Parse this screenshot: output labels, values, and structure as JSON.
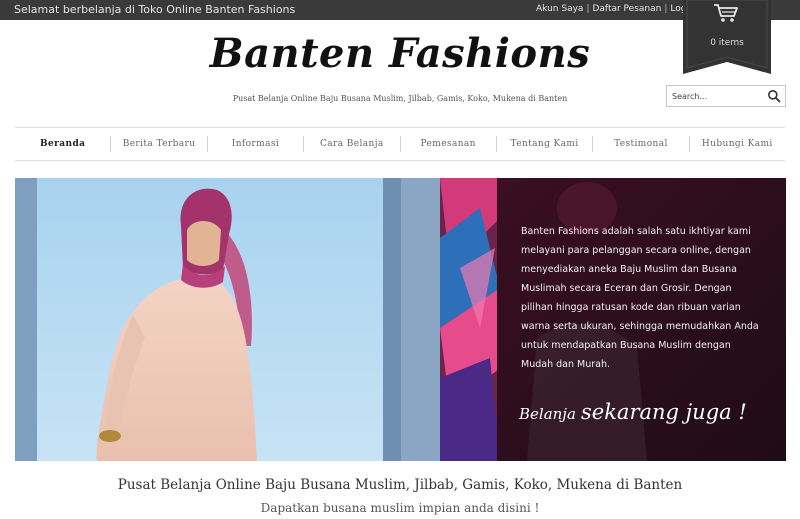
{
  "topbar": {
    "welcome": "Selamat berbelanja di Toko Online Banten Fashions",
    "links": [
      "Akun Saya",
      "Daftar Pesanan",
      "Login"
    ]
  },
  "cart": {
    "items_label": "0 items",
    "icon": "shopping-cart-icon"
  },
  "header": {
    "logo": "Banten Fashions",
    "tagline": "Pusat Belanja Online Baju Busana Muslim, Jilbab, Gamis, Koko, Mukena di Banten"
  },
  "search": {
    "placeholder": "Search..."
  },
  "nav": {
    "items": [
      "Beranda",
      "Berita Terbaru",
      "Informasi",
      "Cara Belanja",
      "Pemesanan",
      "Tentang Kami",
      "Testimonal",
      "Hubungi Kami"
    ],
    "active": "Beranda"
  },
  "banner": {
    "text": "Banten Fashions adalah salah satu ikhtiyar kami melayani para pelanggan secara online, dengan menyediakan aneka Baju Muslim dan Busana Muslimah secara Eceran dan Grosir. Dengan pilihan hingga ratusan kode dan ribuan varian warna serta ukuran, sehingga memudahkan Anda untuk mendapatkan Busana Muslim dengan Mudah dan Murah.",
    "cta_small": "Belanja",
    "cta_big": "sekarang juga !"
  },
  "main": {
    "heading": "Pusat Belanja Online Baju Busana Muslim, Jilbab, Gamis, Koko, Mukena di Banten",
    "subheading": "Dapatkan busana muslim impian anda disini !"
  },
  "colors": {
    "topbar": "#3a3a3a",
    "ribbon": "#333333",
    "banner_dark": "#2b0d1c",
    "banner_light": "#a9cbe6"
  }
}
